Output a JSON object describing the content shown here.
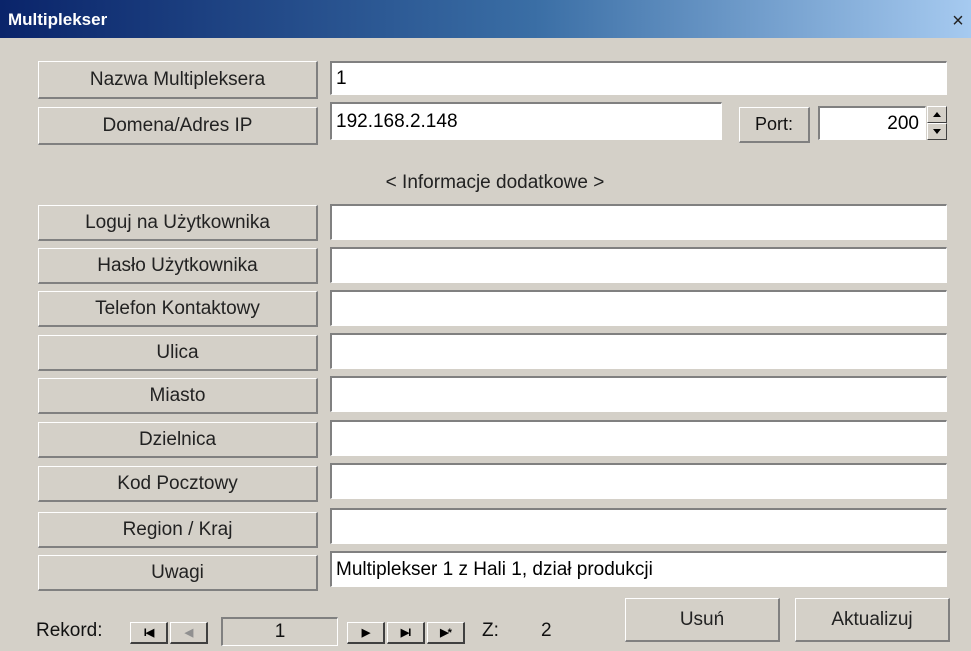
{
  "window": {
    "title": "Multiplekser",
    "close_symbol": "×"
  },
  "fields": {
    "name": {
      "label": "Nazwa Multipleksera",
      "value": "1"
    },
    "domain": {
      "label": "Domena/Adres IP",
      "value": "192.168.2.148"
    },
    "port": {
      "label": "Port:",
      "value": "200"
    }
  },
  "section_heading": "< Informacje dodatkowe >",
  "extra_fields": [
    {
      "label": "Loguj na Użytkownika",
      "value": ""
    },
    {
      "label": "Hasło Użytkownika",
      "value": ""
    },
    {
      "label": "Telefon Kontaktowy",
      "value": ""
    },
    {
      "label": "Ulica",
      "value": ""
    },
    {
      "label": "Miasto",
      "value": ""
    },
    {
      "label": "Dzielnica",
      "value": ""
    },
    {
      "label": "Kod Pocztowy",
      "value": ""
    },
    {
      "label": "Region / Kraj",
      "value": ""
    },
    {
      "label": "Uwagi",
      "value": "Multiplekser 1 z Hali 1, dział produkcji"
    }
  ],
  "navigator": {
    "label": "Rekord:",
    "current": "1",
    "of_label": "Z:",
    "total": "2",
    "first_glyph": "I◀",
    "prev_glyph": "◀",
    "next_glyph": "▶",
    "last_glyph": "▶I",
    "new_glyph": "▶*"
  },
  "buttons": {
    "delete": "Usuń",
    "update": "Aktualizuj"
  }
}
